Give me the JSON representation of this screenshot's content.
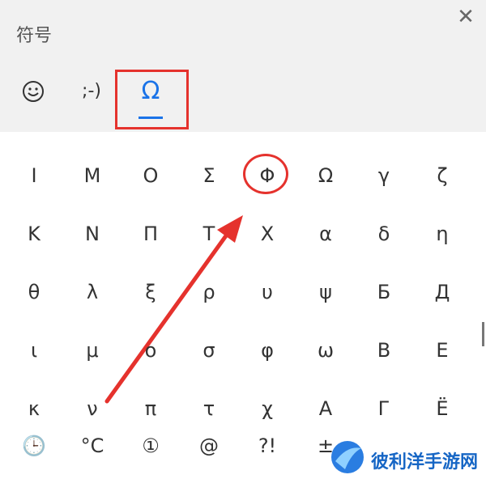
{
  "header": {
    "title": "符号",
    "close_glyph": "✕"
  },
  "tabs": [
    {
      "label": "☺"
    },
    {
      "label": ";-)"
    },
    {
      "label": "Ω"
    }
  ],
  "symbols": [
    [
      "Ι",
      "Μ",
      "Ο",
      "Σ",
      "Φ",
      "Ω",
      "γ",
      "ζ"
    ],
    [
      "Κ",
      "Ν",
      "Π",
      "Τ",
      "Χ",
      "α",
      "δ",
      "η"
    ],
    [
      "θ",
      "λ",
      "ξ",
      "ρ",
      "υ",
      "ψ",
      "Б",
      "Д"
    ],
    [
      "ι",
      "μ",
      "ο",
      "σ",
      "φ",
      "ω",
      "В",
      "Е"
    ],
    [
      "κ",
      "ν",
      "π",
      "τ",
      "χ",
      "А",
      "Г",
      "Ё"
    ]
  ],
  "categories": [
    {
      "label": "🕒",
      "icon": "clock-icon"
    },
    {
      "label": "°C"
    },
    {
      "label": "①"
    },
    {
      "label": "@"
    },
    {
      "label": "?!"
    },
    {
      "label": "±"
    }
  ],
  "watermark": {
    "text": "彼利洋手游网"
  },
  "colors": {
    "accent": "#1a73e8",
    "highlight": "#e5322d"
  }
}
